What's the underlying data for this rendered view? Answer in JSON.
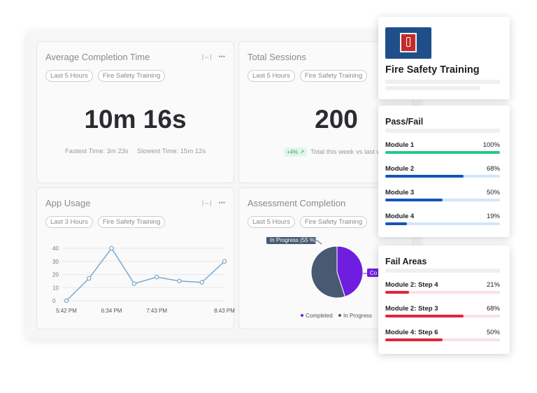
{
  "cards": {
    "avg_completion": {
      "title": "Average Completion Time",
      "chips": [
        "Last 5 Hours",
        "Fire Safety Training"
      ],
      "value": "10m 16s",
      "fastest": "Fastest Time: 3m 23s",
      "slowest": "Slowest Time: 15m 12s"
    },
    "total_sessions": {
      "title": "Total Sessions",
      "chips": [
        "Last 5 Hours",
        "Fire Safety Training"
      ],
      "value": "200",
      "delta": "+4%",
      "comparison": "Total this week vs last w"
    },
    "app_usage": {
      "title": "App Usage",
      "chips": [
        "Last 3 Hours",
        "Fire Safety Training"
      ]
    },
    "assessment": {
      "title": "Assessment Completion",
      "chips": [
        "Last 5 Hours",
        "Fire Safety Training"
      ],
      "pie_label": "In Progress (55 %)",
      "pie_label_right": "Co",
      "legend": [
        "Completed",
        "In Progress"
      ]
    }
  },
  "chart_data": [
    {
      "type": "line",
      "x": [
        "5:42 PM",
        "",
        "6:34 PM",
        "",
        "7:43 PM",
        "",
        "",
        "8:43 PM"
      ],
      "xticks": [
        "5:42 PM",
        "6:34 PM",
        "7:43 PM",
        "8:43 PM"
      ],
      "values": [
        0,
        17,
        40,
        13,
        18,
        15,
        14,
        30
      ],
      "yticks": [
        0,
        10,
        20,
        30,
        40
      ],
      "ylim": [
        0,
        40
      ],
      "grid": true,
      "color": "#7aa9cf"
    },
    {
      "type": "pie",
      "categories": [
        "Completed",
        "In Progress"
      ],
      "values": [
        45,
        55
      ],
      "colors": [
        "#6f1ee0",
        "#475a71"
      ]
    }
  ],
  "training": {
    "title": "Fire Safety Training"
  },
  "pass_fail": {
    "title": "Pass/Fail",
    "items": [
      {
        "label": "Module 1",
        "value": "100%",
        "pct": 1.0,
        "color": "#26c98a",
        "track": "#d7f3e7"
      },
      {
        "label": "Module 2",
        "value": "68%",
        "pct": 0.68,
        "color": "#1456b8",
        "track": "#d4e5f7"
      },
      {
        "label": "Module 3",
        "value": "50%",
        "pct": 0.5,
        "color": "#1456b8",
        "track": "#d4e5f7"
      },
      {
        "label": "Module 4",
        "value": "19%",
        "pct": 0.19,
        "color": "#1456b8",
        "track": "#d4e5f7"
      }
    ]
  },
  "fail_areas": {
    "title": "Fail Areas",
    "items": [
      {
        "label": "Module 2: Step 4",
        "value": "21%",
        "pct": 0.21,
        "color": "#e0263a",
        "track": "#fbe0e3"
      },
      {
        "label": "Module 2: Step 3",
        "value": "68%",
        "pct": 0.68,
        "color": "#e0263a",
        "track": "#fbe0e3"
      },
      {
        "label": "Module 4: Step 6",
        "value": "50%",
        "pct": 0.5,
        "color": "#e0263a",
        "track": "#fbe0e3"
      }
    ]
  }
}
